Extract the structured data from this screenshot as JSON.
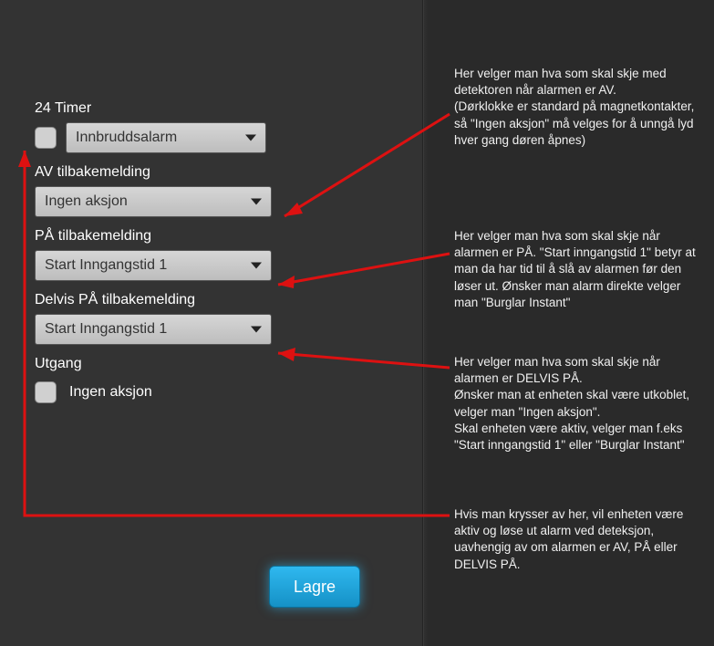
{
  "form": {
    "label_24timer": "24 Timer",
    "select_24timer": "Innbruddsalarm",
    "label_av": "AV tilbakemelding",
    "select_av": "Ingen aksjon",
    "label_pa": "PÅ tilbakemelding",
    "select_pa": "Start Inngangstid 1",
    "label_delvis": "Delvis PÅ tilbakemelding",
    "select_delvis": "Start Inngangstid 1",
    "label_utgang": "Utgang",
    "utgang_text": "Ingen aksjon",
    "save": "Lagre"
  },
  "annotations": {
    "a1": "Her velger man hva som skal skje med detektoren når alarmen er AV.\n(Dørklokke er standard på magnetkontakter, så \"Ingen aksjon\" må velges for å unngå lyd hver gang døren åpnes)",
    "a2": "Her velger man hva som skal skje når alarmen er PÅ. \"Start inngangstid 1\" betyr at man da har tid til å slå av alarmen før den løser ut. Ønsker man alarm direkte velger man \"Burglar Instant\"",
    "a3": "Her velger man hva som skal skje når alarmen er DELVIS PÅ.\nØnsker man at enheten skal være utkoblet, velger man \"Ingen aksjon\".\nSkal enheten være aktiv, velger man f.eks \"Start inngangstid 1\" eller \"Burglar Instant\"",
    "a4": "Hvis man krysser av her, vil enheten være aktiv og løse ut alarm ved deteksjon, uavhengig av om alarmen er AV, PÅ eller DELVIS PÅ."
  }
}
